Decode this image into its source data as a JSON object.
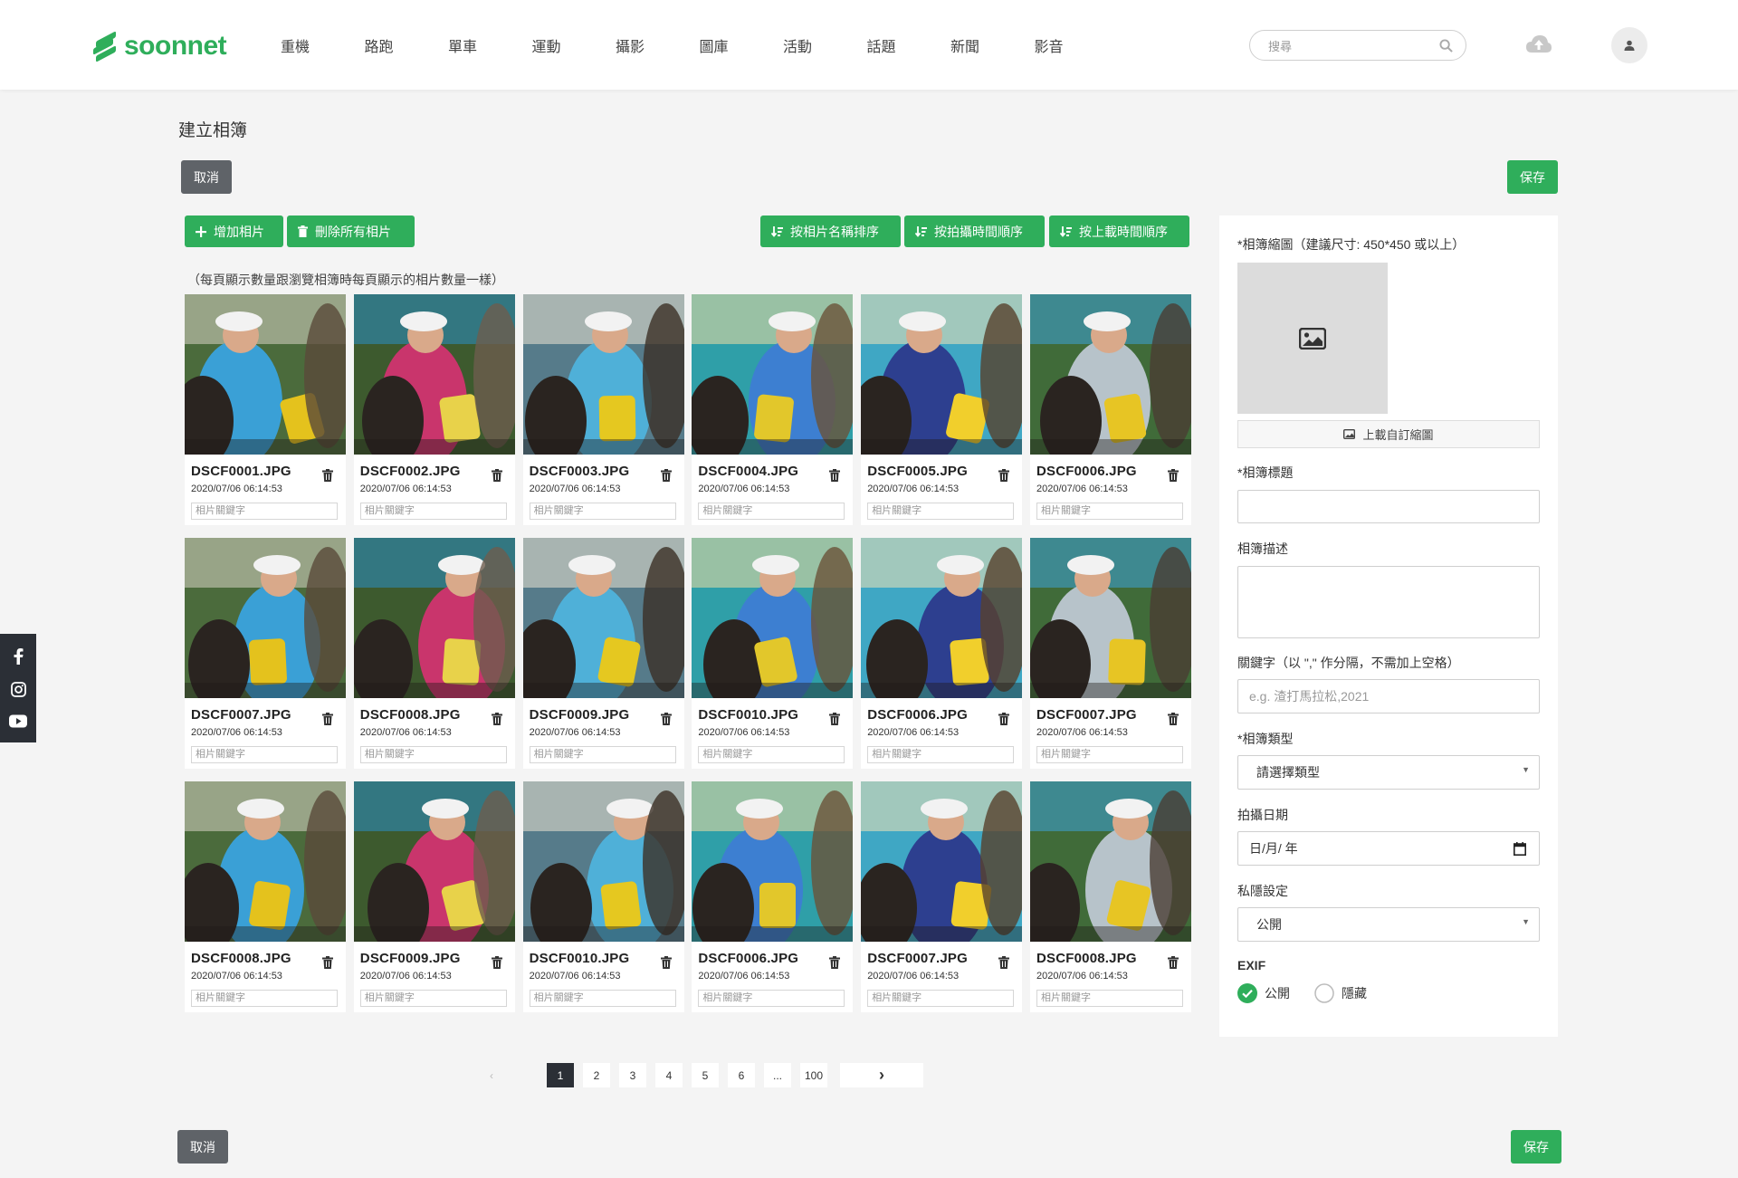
{
  "header": {
    "brand": "soonnet",
    "nav": [
      "重機",
      "路跑",
      "單車",
      "運動",
      "攝影",
      "圖庫",
      "活動",
      "話題",
      "新聞",
      "影音"
    ],
    "search_placeholder": "搜尋",
    "icons": [
      "search-icon",
      "cloud-upload-icon",
      "user-icon"
    ]
  },
  "social": [
    "facebook-icon",
    "instagram-icon",
    "youtube-icon"
  ],
  "page": {
    "title": "建立相簿",
    "cancel_label": "取消",
    "save_label": "保存"
  },
  "toolbar": {
    "add_photo": "增加相片",
    "delete_all": "刪除所有相片",
    "sort_name": "按相片名稱排序",
    "sort_taken": "按拍攝時間順序",
    "sort_upload": "按上載時間順序"
  },
  "note": "（每頁顯示數量跟瀏覽相簿時每頁顯示的相片數量一樣）",
  "photos": [
    {
      "name": "DSCF0001.JPG",
      "date": "2020/07/06 06:14:53",
      "kw": "相片關鍵字"
    },
    {
      "name": "DSCF0002.JPG",
      "date": "2020/07/06 06:14:53",
      "kw": "相片關鍵字"
    },
    {
      "name": "DSCF0003.JPG",
      "date": "2020/07/06 06:14:53",
      "kw": "相片關鍵字"
    },
    {
      "name": "DSCF0004.JPG",
      "date": "2020/07/06 06:14:53",
      "kw": "相片關鍵字"
    },
    {
      "name": "DSCF0005.JPG",
      "date": "2020/07/06 06:14:53",
      "kw": "相片關鍵字"
    },
    {
      "name": "DSCF0006.JPG",
      "date": "2020/07/06 06:14:53",
      "kw": "相片關鍵字"
    },
    {
      "name": "DSCF0007.JPG",
      "date": "2020/07/06 06:14:53",
      "kw": "相片關鍵字"
    },
    {
      "name": "DSCF0008.JPG",
      "date": "2020/07/06 06:14:53",
      "kw": "相片關鍵字"
    },
    {
      "name": "DSCF0009.JPG",
      "date": "2020/07/06 06:14:53",
      "kw": "相片關鍵字"
    },
    {
      "name": "DSCF0010.JPG",
      "date": "2020/07/06 06:14:53",
      "kw": "相片關鍵字"
    },
    {
      "name": "DSCF0006.JPG",
      "date": "2020/07/06 06:14:53",
      "kw": "相片關鍵字"
    },
    {
      "name": "DSCF0007.JPG",
      "date": "2020/07/06 06:14:53",
      "kw": "相片關鍵字"
    },
    {
      "name": "DSCF0008.JPG",
      "date": "2020/07/06 06:14:53",
      "kw": "相片關鍵字"
    },
    {
      "name": "DSCF0009.JPG",
      "date": "2020/07/06 06:14:53",
      "kw": "相片關鍵字"
    },
    {
      "name": "DSCF0010.JPG",
      "date": "2020/07/06 06:14:53",
      "kw": "相片關鍵字"
    },
    {
      "name": "DSCF0006.JPG",
      "date": "2020/07/06 06:14:53",
      "kw": "相片關鍵字"
    },
    {
      "name": "DSCF0007.JPG",
      "date": "2020/07/06 06:14:53",
      "kw": "相片關鍵字"
    },
    {
      "name": "DSCF0008.JPG",
      "date": "2020/07/06 06:14:53",
      "kw": "相片關鍵字"
    }
  ],
  "form": {
    "thumb_label": "*相簿縮圖（建議尺寸: 450*450 或以上）",
    "upload_label": "上載自訂縮圖",
    "title_label": "*相簿標題",
    "title_value": "",
    "desc_label": "相簿描述",
    "desc_value": "",
    "keywords_label": "關鍵字（以 \",\" 作分隔，不需加上空格）",
    "keywords_placeholder": "e.g. 渣打馬拉松,2021",
    "type_label": "*相簿類型",
    "type_value": "請選擇類型",
    "date_label": "拍攝日期",
    "date_value": "日/月/ 年",
    "privacy_label": "私隱設定",
    "privacy_value": "公開",
    "exif_label": "EXIF",
    "exif_public": "公開",
    "exif_hidden": "隱藏",
    "exif_selected": "公開"
  },
  "pagination": {
    "prev": "‹",
    "pages": [
      "1",
      "2",
      "3",
      "4",
      "5",
      "6",
      "...",
      "100"
    ],
    "current": "1",
    "next": "›"
  },
  "colors": {
    "brand_green": "#2fae5b",
    "dark": "#2b2f36",
    "gray_button": "#5f6368"
  }
}
